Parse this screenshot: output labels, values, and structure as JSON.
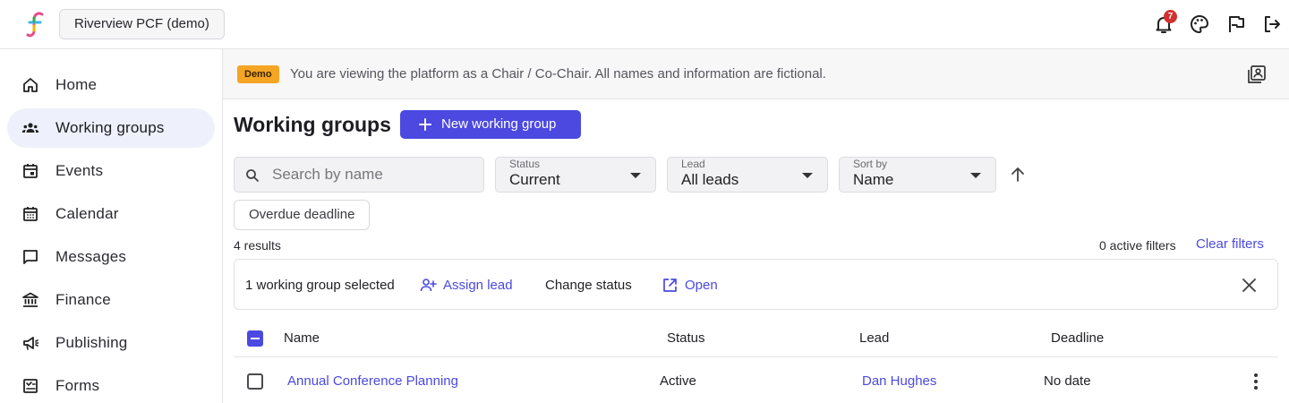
{
  "header": {
    "org_name": "Riverview PCF (demo)",
    "notification_count": "7",
    "icons": [
      "bell-icon",
      "palette-icon",
      "flag-icon",
      "logout-icon"
    ]
  },
  "sidebar": {
    "items": [
      {
        "label": "Home",
        "icon": "home-icon"
      },
      {
        "label": "Working groups",
        "icon": "people-icon",
        "active": true
      },
      {
        "label": "Events",
        "icon": "event-icon"
      },
      {
        "label": "Calendar",
        "icon": "calendar-icon"
      },
      {
        "label": "Messages",
        "icon": "message-icon"
      },
      {
        "label": "Finance",
        "icon": "bank-icon"
      },
      {
        "label": "Publishing",
        "icon": "megaphone-icon"
      },
      {
        "label": "Forms",
        "icon": "form-icon"
      }
    ]
  },
  "banner": {
    "tag": "Demo",
    "text": "You are viewing the platform as a Chair / Co-Chair. All names and information are fictional."
  },
  "page": {
    "title": "Working groups",
    "new_button": "New working group"
  },
  "filters": {
    "search_placeholder": "Search by name",
    "status": {
      "label": "Status",
      "value": "Current"
    },
    "lead": {
      "label": "Lead",
      "value": "All leads"
    },
    "sort": {
      "label": "Sort by",
      "value": "Name"
    },
    "chip": "Overdue deadline",
    "results": "4 results",
    "active_filters": "0 active filters",
    "clear": "Clear filters"
  },
  "selection": {
    "count_text": "1 working group selected",
    "assign": "Assign lead",
    "change_status": "Change status",
    "open": "Open"
  },
  "table": {
    "headers": {
      "name": "Name",
      "status": "Status",
      "lead": "Lead",
      "deadline": "Deadline"
    },
    "rows": [
      {
        "name": "Annual Conference Planning",
        "status": "Active",
        "lead": "Dan Hughes",
        "deadline": "No date"
      }
    ]
  },
  "colors": {
    "accent": "#4b49e0",
    "demo_tag": "#f5a524",
    "badge": "#d32f2f"
  }
}
